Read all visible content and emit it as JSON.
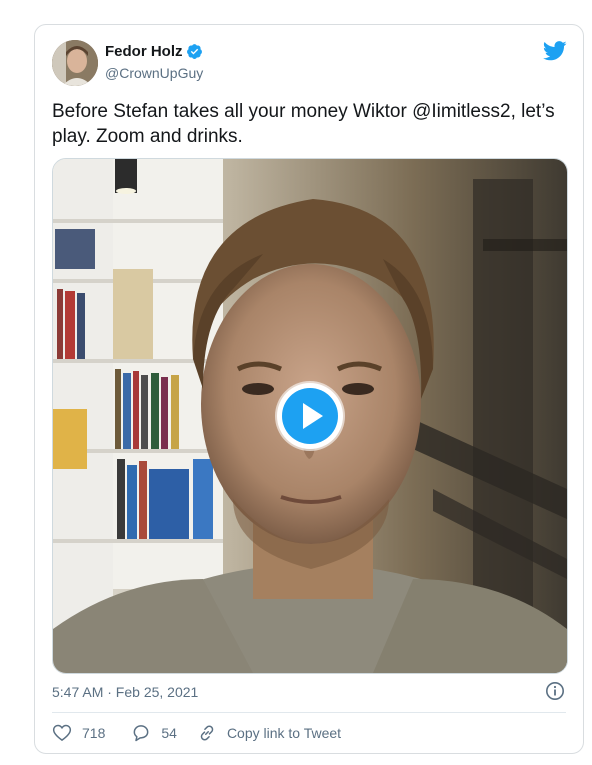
{
  "author": {
    "name": "Fedor Holz",
    "handle": "@CrownUpGuy",
    "verified": true
  },
  "tweet": {
    "text": "Before Stefan takes all your money Wiktor @Iimitless2, let’s play. Zoom and drinks.",
    "timestamp": "5:47 AM · Feb 25, 2021"
  },
  "media": {
    "type": "video",
    "control": "play-button"
  },
  "actions": {
    "likes": "718",
    "replies": "54",
    "copy_link_label": "Copy link to Tweet"
  },
  "colors": {
    "brand": "#1DA1F2",
    "text_primary": "#14171A",
    "text_secondary": "#5B7083",
    "border": "#D9DDE0"
  },
  "icons": [
    "twitter-bird-icon",
    "verified-badge-icon",
    "play-icon",
    "info-icon",
    "heart-icon",
    "reply-icon",
    "link-icon"
  ]
}
